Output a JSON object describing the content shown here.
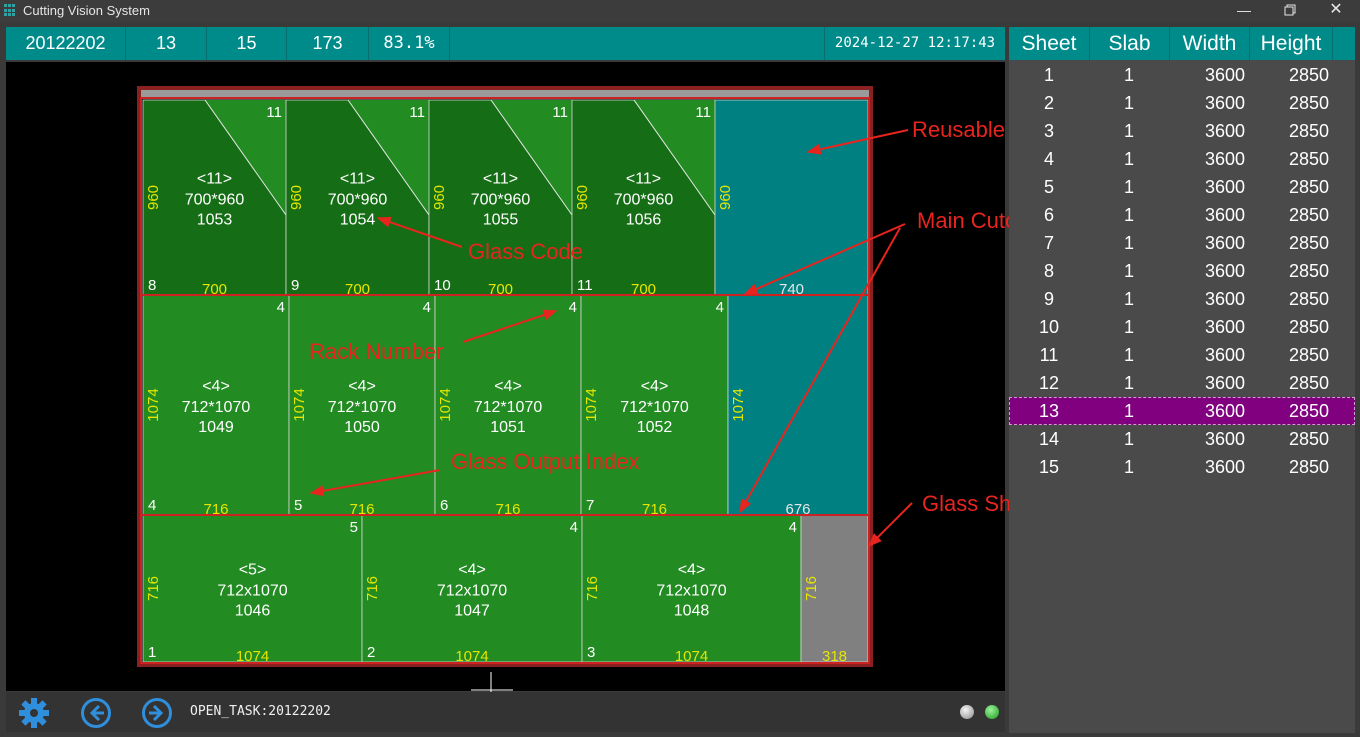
{
  "window": {
    "title": "Cutting Vision System",
    "minimize_icon": "minimize-icon",
    "maximize_icon": "restore-icon",
    "close_icon": "close-icon"
  },
  "header": {
    "task_id": "20122202",
    "sheet_number": "13",
    "sheet_total": "15",
    "piece_count": "173",
    "utilization": "83.1%",
    "datetime": "2024-12-27 12:17:43"
  },
  "table": {
    "headers": [
      "Sheet",
      "Slab",
      "Width",
      "Height"
    ],
    "rows": [
      [
        "1",
        "1",
        "3600",
        "2850"
      ],
      [
        "2",
        "1",
        "3600",
        "2850"
      ],
      [
        "3",
        "1",
        "3600",
        "2850"
      ],
      [
        "4",
        "1",
        "3600",
        "2850"
      ],
      [
        "5",
        "1",
        "3600",
        "2850"
      ],
      [
        "6",
        "1",
        "3600",
        "2850"
      ],
      [
        "7",
        "1",
        "3600",
        "2850"
      ],
      [
        "8",
        "1",
        "3600",
        "2850"
      ],
      [
        "9",
        "1",
        "3600",
        "2850"
      ],
      [
        "10",
        "1",
        "3600",
        "2850"
      ],
      [
        "11",
        "1",
        "3600",
        "2850"
      ],
      [
        "12",
        "1",
        "3600",
        "2850"
      ],
      [
        "13",
        "1",
        "3600",
        "2850"
      ],
      [
        "14",
        "1",
        "3600",
        "2850"
      ],
      [
        "15",
        "1",
        "3600",
        "2850"
      ]
    ],
    "selected_row": 13,
    "selected_color": "#800080"
  },
  "layout": {
    "pieces": [
      {
        "rack": "11",
        "code": "<11>",
        "size": "700*960",
        "id": "1053",
        "index": "8",
        "width_label": "700",
        "height_label": "960"
      },
      {
        "rack": "11",
        "code": "<11>",
        "size": "700*960",
        "id": "1054",
        "index": "9",
        "width_label": "700",
        "height_label": "960"
      },
      {
        "rack": "11",
        "code": "<11>",
        "size": "700*960",
        "id": "1055",
        "index": "10",
        "width_label": "700",
        "height_label": "960"
      },
      {
        "rack": "11",
        "code": "<11>",
        "size": "700*960",
        "id": "1056",
        "index": "11",
        "width_label": "700",
        "height_label": "960"
      },
      {
        "rack": "4",
        "code": "<4>",
        "size": "712*1070",
        "id": "1049",
        "index": "4",
        "width_label": "716",
        "height_label": "1074"
      },
      {
        "rack": "4",
        "code": "<4>",
        "size": "712*1070",
        "id": "1050",
        "index": "5",
        "width_label": "716",
        "height_label": "1074"
      },
      {
        "rack": "4",
        "code": "<4>",
        "size": "712*1070",
        "id": "1051",
        "index": "6",
        "width_label": "716",
        "height_label": "1074"
      },
      {
        "rack": "4",
        "code": "<4>",
        "size": "712*1070",
        "id": "1052",
        "index": "7",
        "width_label": "716",
        "height_label": "1074"
      },
      {
        "rack": "5",
        "code": "<5>",
        "size": "712x1070",
        "id": "1046",
        "index": "1",
        "width_label": "1074",
        "height_label": "716"
      },
      {
        "rack": "4",
        "code": "<4>",
        "size": "712x1070",
        "id": "1047",
        "index": "2",
        "width_label": "1074",
        "height_label": "716"
      },
      {
        "rack": "4",
        "code": "<4>",
        "size": "712x1070",
        "id": "1048",
        "index": "3",
        "width_label": "1074",
        "height_label": "716"
      }
    ],
    "remnants": [
      {
        "width_label": "740",
        "height_label": "960"
      },
      {
        "width_label": "676",
        "height_label": "1074"
      },
      {
        "width_label": "318",
        "height_label": "716"
      }
    ],
    "colors": {
      "dark_piece": "#156e15",
      "light_piece": "#228b22",
      "remnant": "#008080",
      "trim": "#808080",
      "border": "#cc2222",
      "label_yellow": "#e6e600"
    }
  },
  "annotations": {
    "reusable_glass": "Reusable Glass",
    "main_cutoff_line": "Main Cutoff Line",
    "glass_code": "Glass Code",
    "rack_number": "Rack Number",
    "glass_output_index": "Glass Output Index",
    "glass_sheet_trimming": "Glass Sheet Trimming"
  },
  "footer": {
    "status_text": "OPEN_TASK:20122202",
    "settings_icon": "gear-icon",
    "prev_icon": "arrow-left-icon",
    "next_icon": "arrow-right-icon",
    "status_lights": [
      "grey-light-icon",
      "green-light-icon"
    ]
  }
}
